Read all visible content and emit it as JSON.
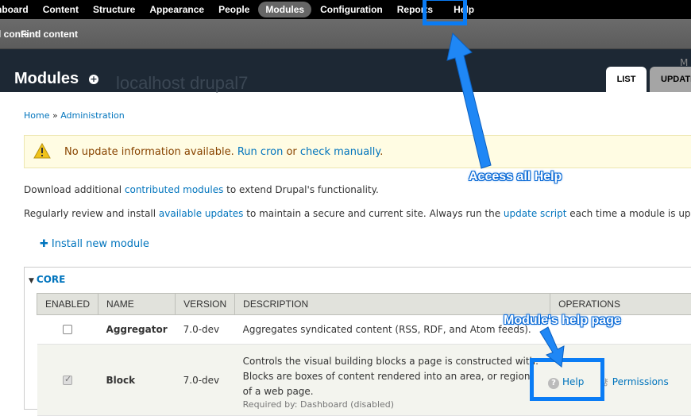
{
  "toolbar": {
    "items": [
      "Dashboard",
      "Content",
      "Structure",
      "Appearance",
      "People",
      "Modules",
      "Configuration",
      "Reports",
      "Help"
    ],
    "active": "Modules"
  },
  "shortcuts": {
    "items": [
      "Add content",
      "Find content"
    ]
  },
  "header": {
    "title": "Modules",
    "site_name": "localhost drupal7",
    "corner": "M",
    "tabs": [
      "LIST",
      "UPDATE"
    ]
  },
  "breadcrumb": {
    "home": "Home",
    "sep": " » ",
    "admin": "Administration"
  },
  "message": {
    "text": "No update information available. ",
    "run_cron": "Run cron",
    "or": " or ",
    "check": "check manually",
    "end": "."
  },
  "intro": {
    "p1_pre": "Download additional ",
    "p1_link": "contributed modules",
    "p1_post": " to extend Drupal's functionality.",
    "p2_pre": "Regularly review and install ",
    "p2_link": "available updates",
    "p2_mid": " to maintain a secure and current site. Always run the ",
    "p2_link2": "update script",
    "p2_post": " each time a module is updated."
  },
  "install_link": "Install new module",
  "fieldset_title": "CORE",
  "table": {
    "headers": [
      "ENABLED",
      "NAME",
      "VERSION",
      "DESCRIPTION",
      "OPERATIONS"
    ],
    "rows": [
      {
        "name": "Aggregator",
        "version": "7.0-dev",
        "description": "Aggregates syndicated content (RSS, RDF, and Atom feeds).",
        "enabled": false
      },
      {
        "name": "Block",
        "version": "7.0-dev",
        "description": "Controls the visual building blocks a page is constructed with. Blocks are boxes of content rendered into an area, or region, of a web page.",
        "required": "Required by: Dashboard (disabled)",
        "enabled": true,
        "op_help": "Help",
        "op_perm": "Permissions"
      }
    ]
  },
  "annotations": {
    "access_all_help": "Access all Help",
    "module_help_page": "Module's help page"
  },
  "colors": {
    "accent": "#0a7cf5",
    "link": "#0074bd",
    "header_bg": "#1d2834"
  }
}
